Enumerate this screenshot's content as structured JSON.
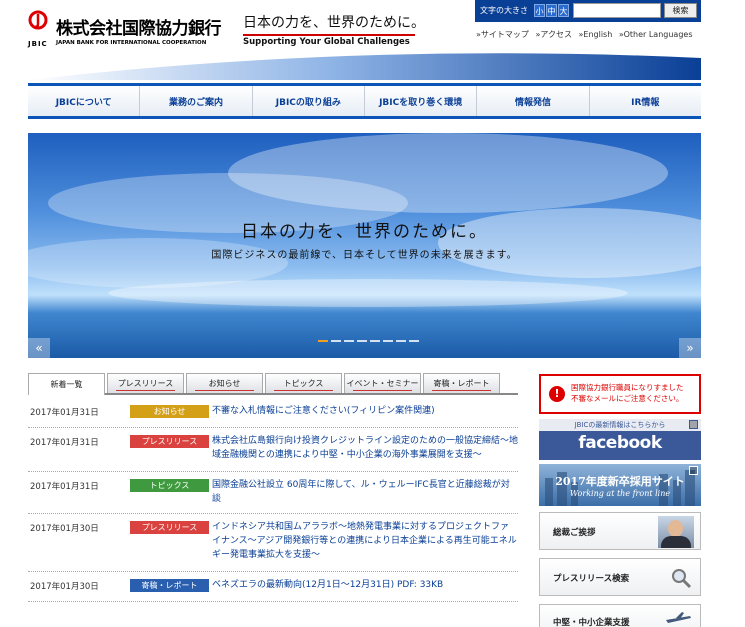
{
  "header": {
    "logo_jbic": "JBIC",
    "logo_name": "株式会社国際協力銀行",
    "logo_sub": "JAPAN BANK FOR INTERNATIONAL COOPERATION",
    "slogan_jp": "日本の力を、世界のために。",
    "slogan_en": "Supporting Your Global Challenges"
  },
  "toolbox": {
    "font_size_label": "文字の大きさ",
    "font_sizes": [
      "小",
      "中",
      "大"
    ],
    "search_placeholder": "",
    "search_button": "検索"
  },
  "util_links": [
    "»サイトマップ",
    "»アクセス",
    "»English",
    "»Other Languages"
  ],
  "nav": [
    "JBICについて",
    "業務のご案内",
    "JBICの取り組み",
    "JBICを取り巻く環境",
    "情報発信",
    "IR情報"
  ],
  "hero": {
    "title": "日本の力を、世界のために。",
    "subtitle": "国際ビジネスの最前線で、日本そして世界の未来を展きます。",
    "prev": "«",
    "next": "»",
    "slide_count": 8,
    "active_slide": 0
  },
  "tabs": [
    "新着一覧",
    "プレスリリース",
    "お知らせ",
    "トピックス",
    "イベント・セミナー",
    "寄稿・レポート"
  ],
  "news": [
    {
      "date": "2017年01月31日",
      "category": "お知らせ",
      "color": "#d4a017",
      "title": "不審な入札情報にご注意ください(フィリピン案件関連)"
    },
    {
      "date": "2017年01月31日",
      "category": "プレスリリース",
      "color": "#d9423e",
      "title": "株式会社広島銀行向け投資クレジットライン設定のための一般協定締結～地域金融機関との連携により中堅・中小企業の海外事業展開を支援～"
    },
    {
      "date": "2017年01月31日",
      "category": "トピックス",
      "color": "#3f9a3f",
      "title": "国際金融公社設立 60周年に際して、ル・ウェルーIFC長官と近藤総裁が対談"
    },
    {
      "date": "2017年01月30日",
      "category": "プレスリリース",
      "color": "#d9423e",
      "title": "インドネシア共和国ムアララボ～地熱発電事業に対するプロジェクトファイナンス～アジア開発銀行等との連携により日本企業による再生可能エネルギー発電事業拡大を支援～"
    },
    {
      "date": "2017年01月30日",
      "category": "寄稿・レポート",
      "color": "#2a5fb0",
      "title": "ベネズエラの最新動向(12月1日～12月31日) PDF: 33KB"
    }
  ],
  "sidebar": {
    "alert_line1": "国際協力銀行職員になりすました",
    "alert_line2": "不審なメールにご注意ください。",
    "fb_caption": "JBICの最新情報はこちらから",
    "fb_word": "facebook",
    "recruit_title": "2017年度新卒採用サイト",
    "recruit_sub": "Working at the front line",
    "greeting": "総裁ご挨拶",
    "press_search": "プレスリリース検索",
    "sme": "中堅・中小企業支援"
  }
}
